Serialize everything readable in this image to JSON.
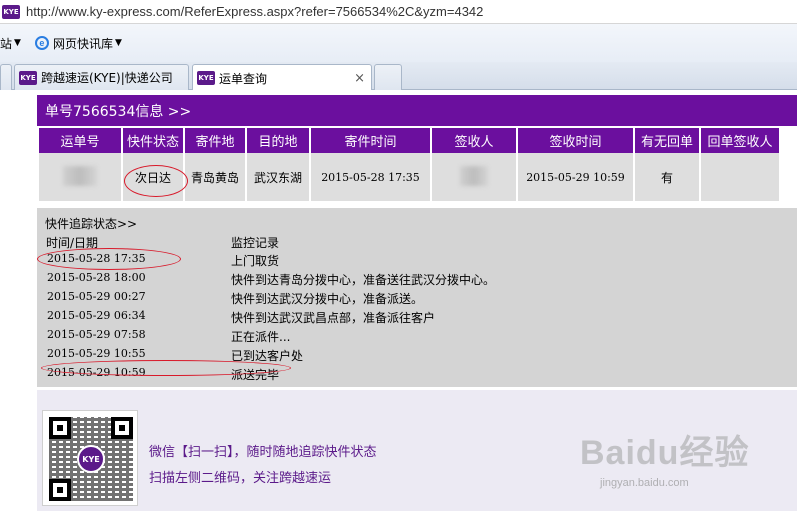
{
  "browser": {
    "url": "http://www.ky-express.com/ReferExpress.aspx?refer=7566534%2C&yzm=4342",
    "site_icon_text": "KYE",
    "favorites_left": "站",
    "favorites_item": "网页快讯库",
    "tabs": [
      {
        "label": "跨越速运(KYE)|快递公司"
      },
      {
        "label": "运单查询",
        "close": "×"
      }
    ]
  },
  "header": {
    "title": "单号7566534信息 >>"
  },
  "info_table": {
    "columns": [
      "运单号",
      "快件状态",
      "寄件地",
      "目的地",
      "寄件时间",
      "签收人",
      "签收时间",
      "有无回单",
      "回单签收人"
    ],
    "row": {
      "waybill": "",
      "status": "次日达",
      "origin": "青岛黄岛",
      "destination": "武汉东湖",
      "send_time": "2015-05-28 17:35",
      "signer": "",
      "sign_time": "2015-05-29 10:59",
      "has_receipt": "有",
      "receipt_signer": ""
    }
  },
  "tracking": {
    "title": "快件追踪状态>>",
    "col_time": "时间/日期",
    "col_record": "监控记录",
    "events": [
      {
        "time": "2015-05-28  17:35",
        "record": "上门取货"
      },
      {
        "time": "2015-05-28  18:00",
        "record": "快件到达青岛分拨中心，准备送往武汉分拨中心。"
      },
      {
        "time": "2015-05-29  00:27",
        "record": "快件到达武汉分拨中心，准备派送。"
      },
      {
        "time": "2015-05-29  06:34",
        "record": "快件到达武汉武昌点部，准备派往客户"
      },
      {
        "time": "2015-05-29  07:58",
        "record": "正在派件..."
      },
      {
        "time": "2015-05-29  10:55",
        "record": "已到达客户处"
      },
      {
        "time": "2015-05-29  10:59",
        "record": "派送完毕"
      }
    ]
  },
  "footer": {
    "qr_logo": "KYE",
    "line1": "微信【扫一扫】，随时随地追踪快件状态",
    "line2": "扫描左侧二维码，关注跨越速运"
  },
  "watermark": {
    "brand": "Baidu经验",
    "sub": "jingyan.baidu.com"
  },
  "colors": {
    "purple": "#6b0f9e",
    "annotation_red": "#d8192a",
    "gray_bg": "#d4d4d4"
  }
}
